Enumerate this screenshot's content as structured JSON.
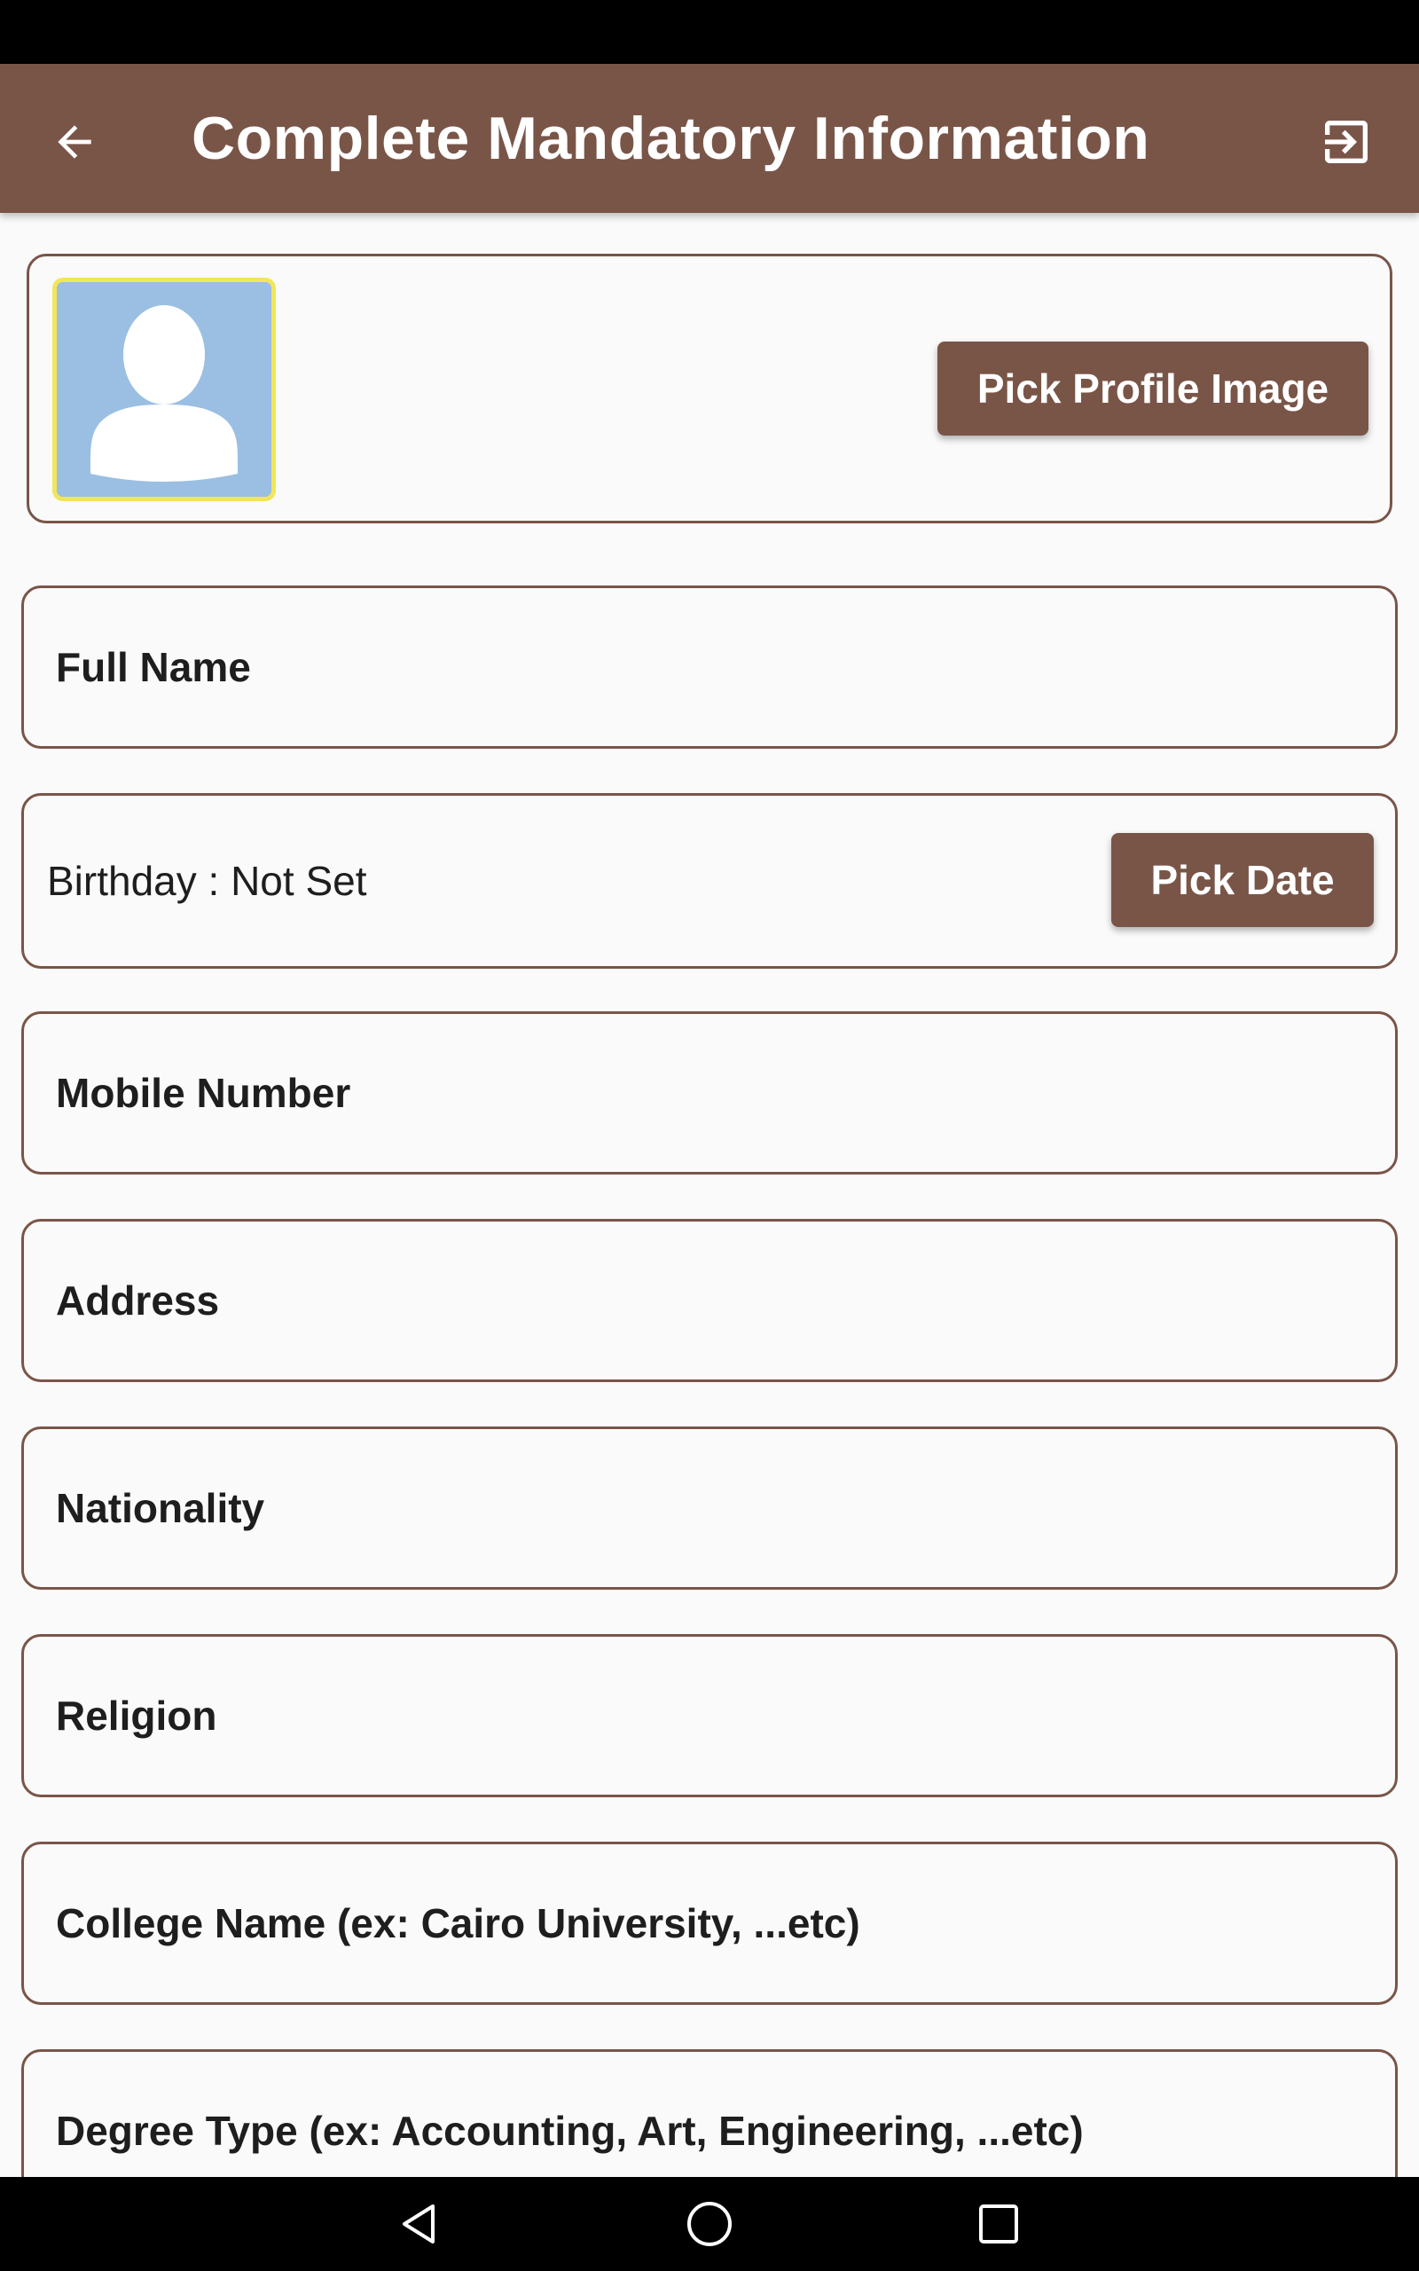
{
  "app_bar": {
    "title": "Complete Mandatory Information",
    "background_color": "#795548",
    "back_icon": "arrow-left-icon",
    "exit_icon": "exit-to-app-icon"
  },
  "profile_image": {
    "avatar_icon": "person-placeholder-icon",
    "avatar_background": "#9abfe2",
    "avatar_border": "#f1e65a",
    "pick_button_label": "Pick Profile Image"
  },
  "fields": {
    "full_name": "Full Name",
    "mobile_number": "Mobile Number",
    "address": "Address",
    "nationality": "Nationality",
    "religion": "Religion",
    "college_name": "College Name (ex: Cairo University, ...etc)",
    "degree_type": "Degree Type (ex: Accounting, Art, Engineering, ...etc)"
  },
  "birthday": {
    "text": "Birthday : Not Set",
    "pick_button_label": "Pick Date"
  },
  "nav_bar": {
    "back_icon": "nav-back-triangle-icon",
    "home_icon": "nav-home-circle-icon",
    "recents_icon": "nav-recents-square-icon"
  }
}
